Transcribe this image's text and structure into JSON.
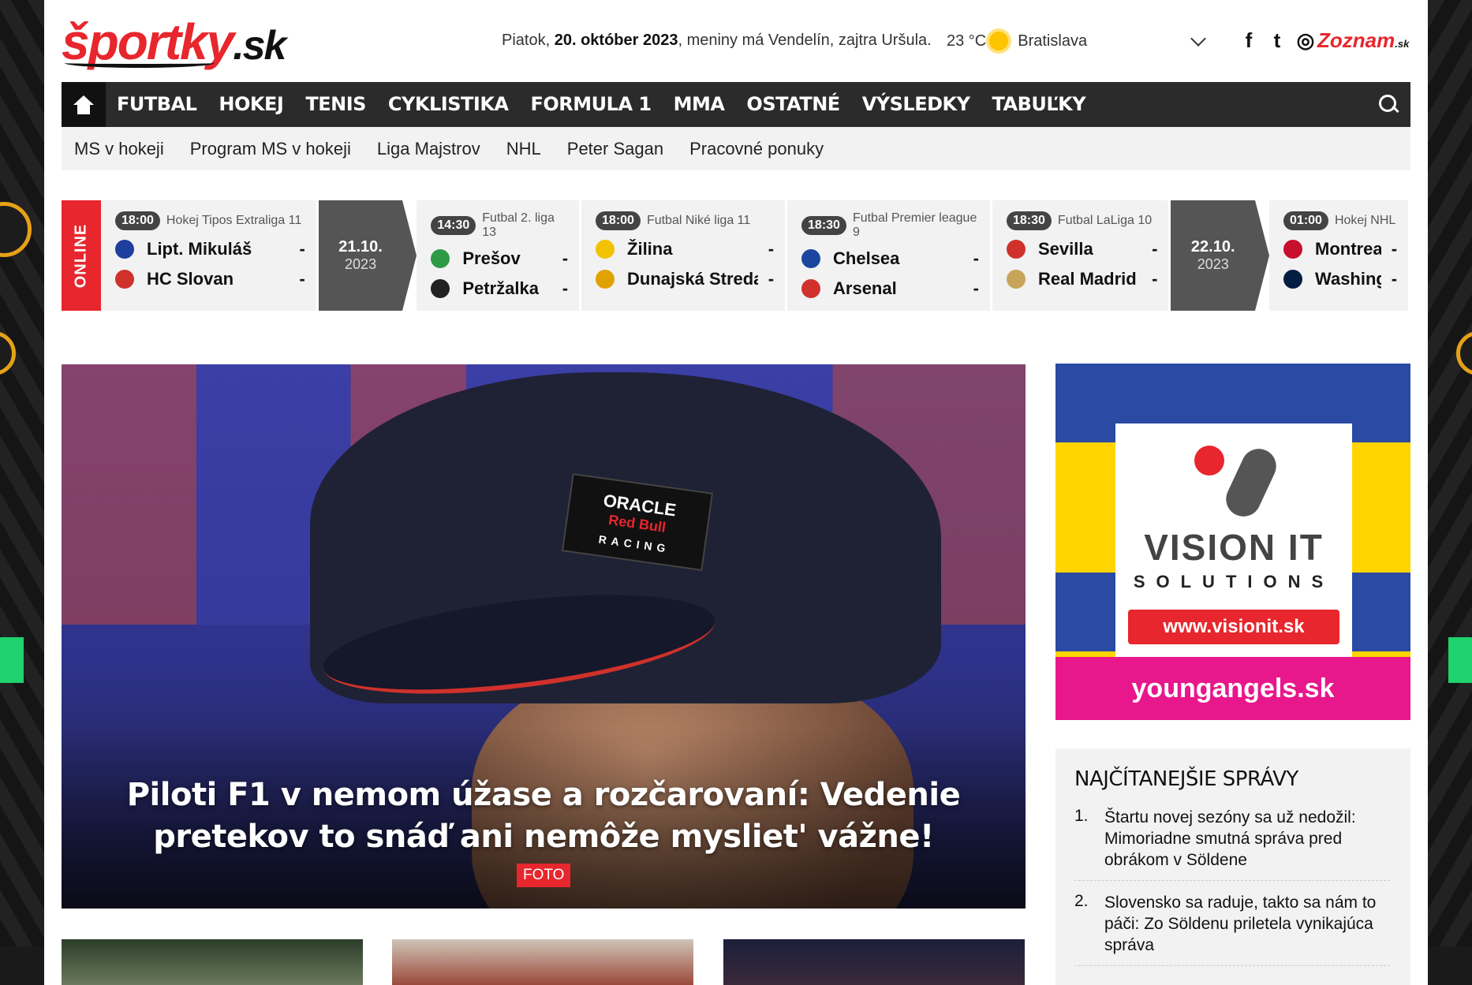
{
  "header": {
    "logo_main": "športky",
    "logo_tld": ".sk",
    "date_prefix": "Piatok, ",
    "date_bold": "20. október 2023",
    "date_suffix": ", meniny má Vendelín, zajtra Uršula.",
    "temperature": "23 °C",
    "city": "Bratislava",
    "social": [
      {
        "icon": "facebook-icon",
        "glyph": "f"
      },
      {
        "icon": "twitter-icon",
        "glyph": "t"
      },
      {
        "icon": "instagram-icon",
        "glyph": "◎"
      }
    ],
    "partner": "Zoznam",
    "partner_tld": ".sk"
  },
  "nav": {
    "items": [
      "FUTBAL",
      "HOKEJ",
      "TENIS",
      "CYKLISTIKA",
      "FORMULA 1",
      "MMA",
      "OSTATNÉ",
      "VÝSLEDKY",
      "TABUĽKY"
    ]
  },
  "subnav": {
    "items": [
      "MS v hokeji",
      "Program MS v hokeji",
      "Liga Majstrov",
      "NHL",
      "Peter Sagan",
      "Pracovné ponuky"
    ]
  },
  "scores": {
    "online_label": "ONLINE",
    "blocks": [
      {
        "kind": "match",
        "time": "18:00",
        "league": "Hokej Tipos Extraliga 11",
        "teams": [
          {
            "name": "Lipt. Mikuláš",
            "score": "-",
            "color": "#1e3f9e"
          },
          {
            "name": "HC Slovan",
            "score": "-",
            "color": "#d0312b"
          }
        ]
      },
      {
        "kind": "date",
        "date": "21.10.",
        "year": "2023"
      },
      {
        "kind": "match",
        "time": "14:30",
        "league": "Futbal 2. liga 13",
        "teams": [
          {
            "name": "Prešov",
            "score": "-",
            "color": "#2d9a46"
          },
          {
            "name": "Petržalka",
            "score": "-",
            "color": "#222222"
          }
        ]
      },
      {
        "kind": "match",
        "time": "18:00",
        "league": "Futbal Niké liga 11",
        "teams": [
          {
            "name": "Žilina",
            "score": "-",
            "color": "#f2c200"
          },
          {
            "name": "Dunajská Streda",
            "score": "-",
            "color": "#e0a200"
          }
        ]
      },
      {
        "kind": "match",
        "time": "18:30",
        "league": "Futbal Premier league 9",
        "teams": [
          {
            "name": "Chelsea",
            "score": "-",
            "color": "#1b46a0"
          },
          {
            "name": "Arsenal",
            "score": "-",
            "color": "#d0312b"
          }
        ]
      },
      {
        "kind": "match",
        "time": "18:30",
        "league": "Futbal LaLiga 10",
        "teams": [
          {
            "name": "Sevilla",
            "score": "-",
            "color": "#d0312b"
          },
          {
            "name": "Real Madrid",
            "score": "-",
            "color": "#c8a45a"
          }
        ]
      },
      {
        "kind": "date",
        "date": "22.10.",
        "year": "2023"
      },
      {
        "kind": "match",
        "time": "01:00",
        "league": "Hokej NHL",
        "teams": [
          {
            "name": "Montreal",
            "score": "-",
            "color": "#c8102e"
          },
          {
            "name": "Washington",
            "score": "-",
            "color": "#041e42"
          }
        ]
      }
    ]
  },
  "hero": {
    "title": "Piloti F1 v nemom úžase a rozčarovaní: Vedenie pretekov to snáď ani nemôže mysliet' vážne!",
    "badge": "FOTO",
    "patch_line1": "ORACLE",
    "patch_line2": "Red Bull",
    "patch_line3": "RACING"
  },
  "ad": {
    "brand": "VISION IT",
    "sub": "SOLUTIONS",
    "url": "www.visionit.sk",
    "footer": "youngangels.sk"
  },
  "mostread": {
    "title": "NAJČÍTANEJŠIE SPRÁVY",
    "items": [
      {
        "num": "1.",
        "text": "Štartu novej sezóny sa už nedožil: Mimoriadne smutná správa pred obrákom v Söldene"
      },
      {
        "num": "2.",
        "text": "Slovensko sa raduje, takto sa nám to páči: Zo Söldenu priletela vynikajúca správa"
      }
    ]
  },
  "colors": {
    "brand_red": "#e8262d",
    "nav_dark": "#2b2b2b",
    "ad_pink": "#e8178c",
    "ad_yellow": "#ffd400"
  }
}
